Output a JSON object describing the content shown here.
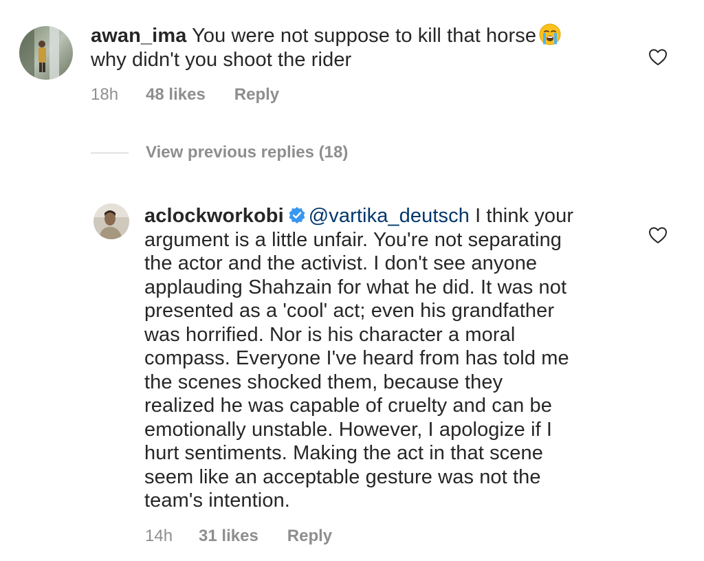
{
  "comment": {
    "username": "awan_ima",
    "text_line1": "You were not suppose to kill that horse",
    "emoji": "loudly-crying-face-emoji",
    "text_line2": "why didn't you shoot the rider",
    "time": "18h",
    "likes": "48 likes",
    "reply_label": "Reply"
  },
  "view_previous_replies": "View previous replies (18)",
  "reply": {
    "username": "aclockworkobi",
    "verified_icon": "verified-badge-icon",
    "mention": "@vartika_deutsch",
    "lines": [
      "I think your",
      "argument is a little unfair. You're not separating",
      "the actor and the activist. I don't see anyone",
      "applauding Shahzain for what he did. It was not",
      "presented as a 'cool' act; even his grandfather",
      "was horrified. Nor is his character a moral",
      "compass. Everyone I've heard from has told me",
      "the scenes shocked them, because they",
      "realized he was capable of cruelty and can be",
      "emotionally unstable. However, I apologize if I",
      "hurt sentiments. Making the act in that scene",
      "seem like an acceptable gesture was not the",
      "team's intention."
    ],
    "time": "14h",
    "likes": "31 likes",
    "reply_label": "Reply"
  },
  "colors": {
    "text": "#262626",
    "secondary": "#8e8e8e",
    "mention": "#00376b",
    "verified": "#3897f0"
  }
}
